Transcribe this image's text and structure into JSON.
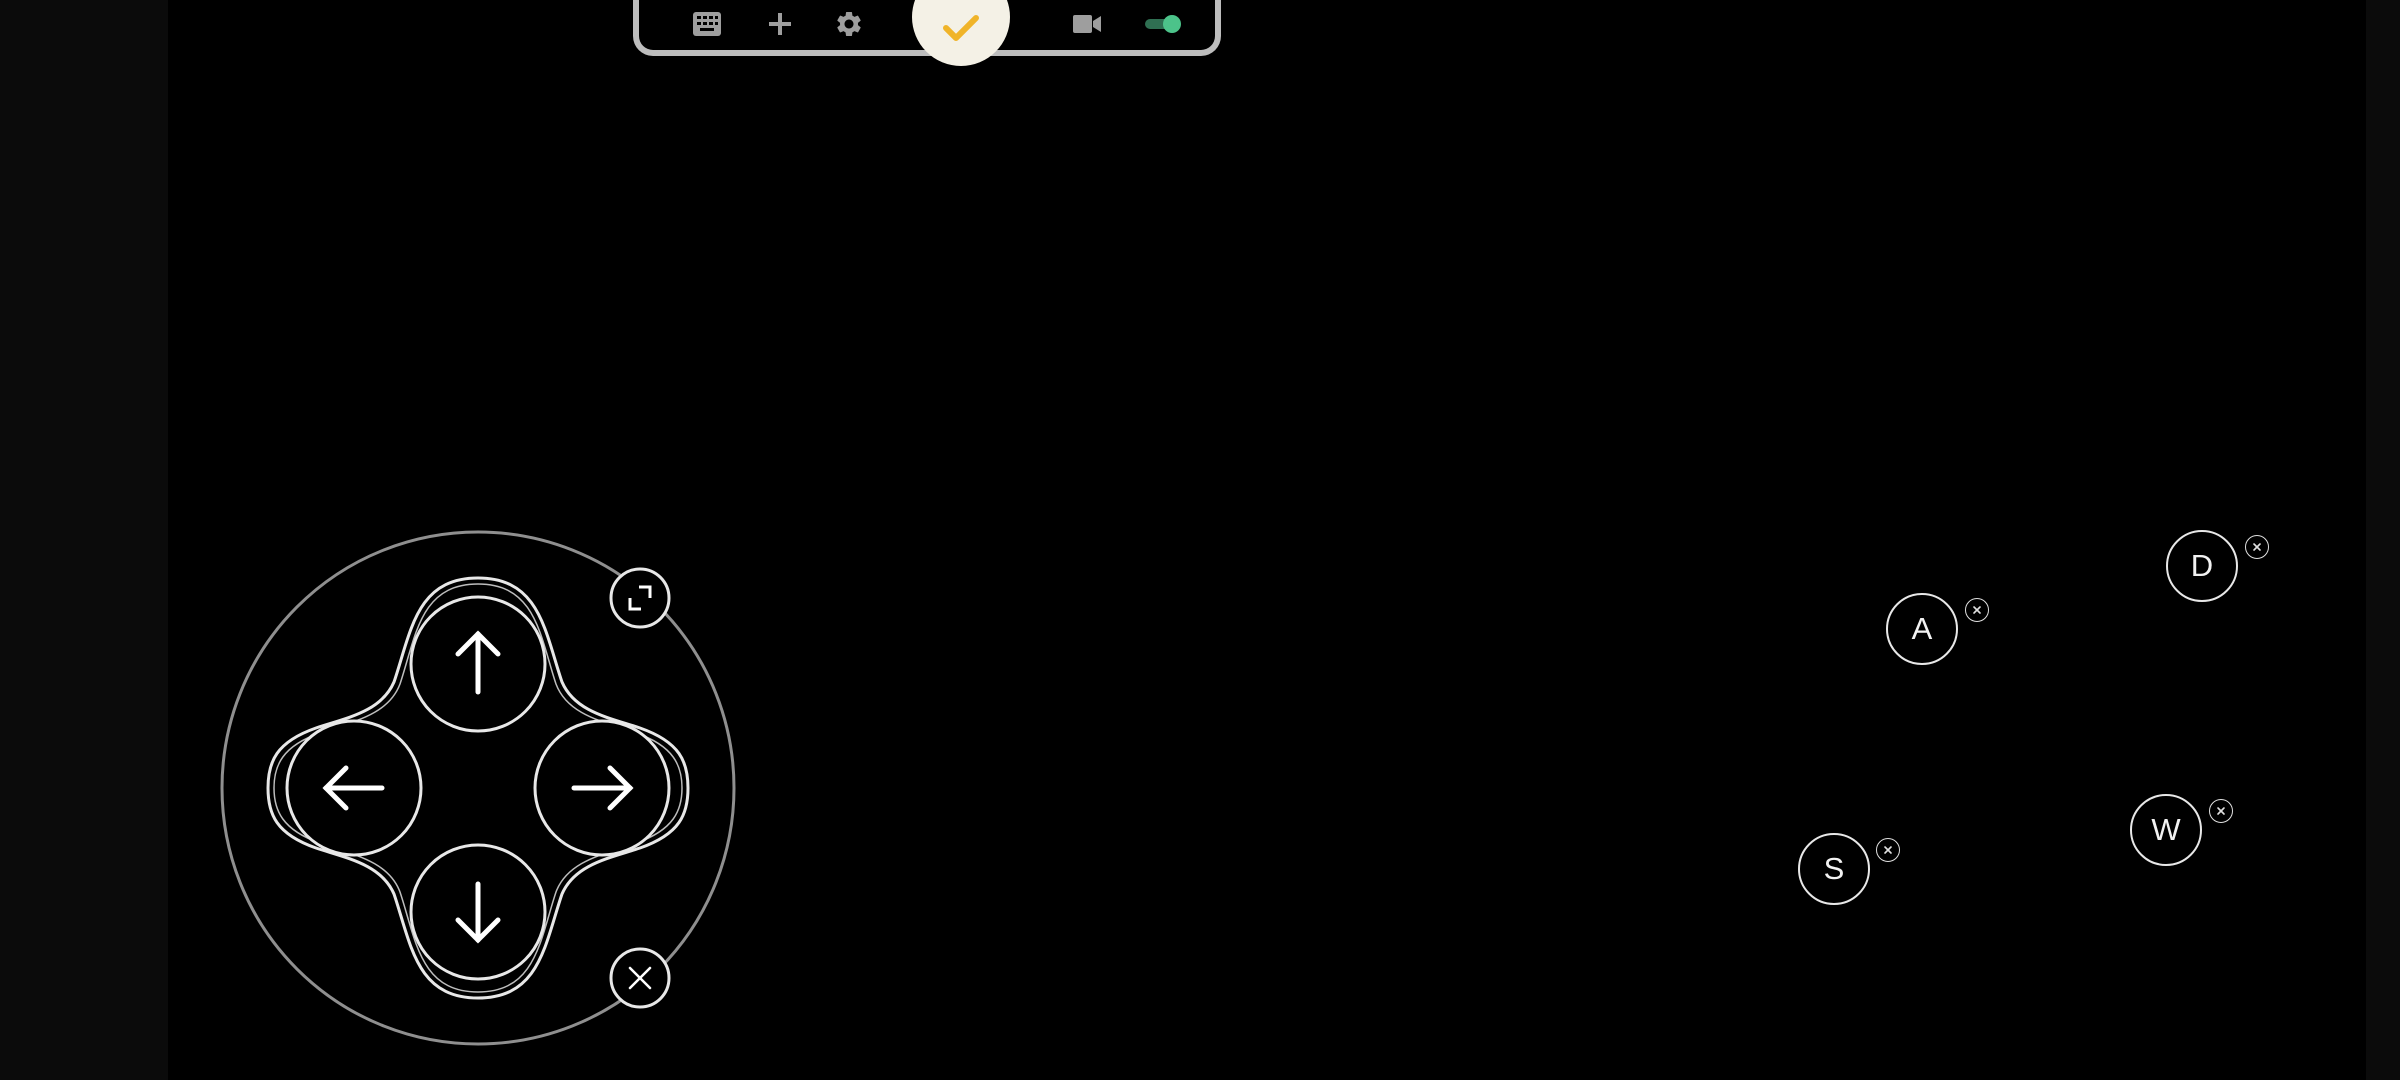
{
  "toolbar": {
    "items": [
      {
        "name": "keyboard",
        "icon": "keyboard-icon"
      },
      {
        "name": "add",
        "icon": "plus-icon"
      },
      {
        "name": "settings",
        "icon": "gear-icon"
      },
      {
        "name": "done",
        "icon": "check-icon"
      },
      {
        "name": "record",
        "icon": "video-camera-icon"
      },
      {
        "name": "toggle",
        "icon": "toggle-icon",
        "state": "on"
      }
    ]
  },
  "dpad": {
    "directions": [
      "up",
      "left",
      "right",
      "down"
    ],
    "controls": [
      {
        "name": "resize",
        "icon": "resize-icon"
      },
      {
        "name": "remove",
        "icon": "close-icon"
      }
    ]
  },
  "keys": [
    {
      "label": "D"
    },
    {
      "label": "A"
    },
    {
      "label": "W"
    },
    {
      "label": "S"
    }
  ],
  "colors": {
    "background": "#000000",
    "toolbar_border": "#bdbdbd",
    "icon": "#9e9e9e",
    "accent_check": "#f0b429",
    "toggle_on": "#4cc38a",
    "outline": "#e8e8e8"
  }
}
